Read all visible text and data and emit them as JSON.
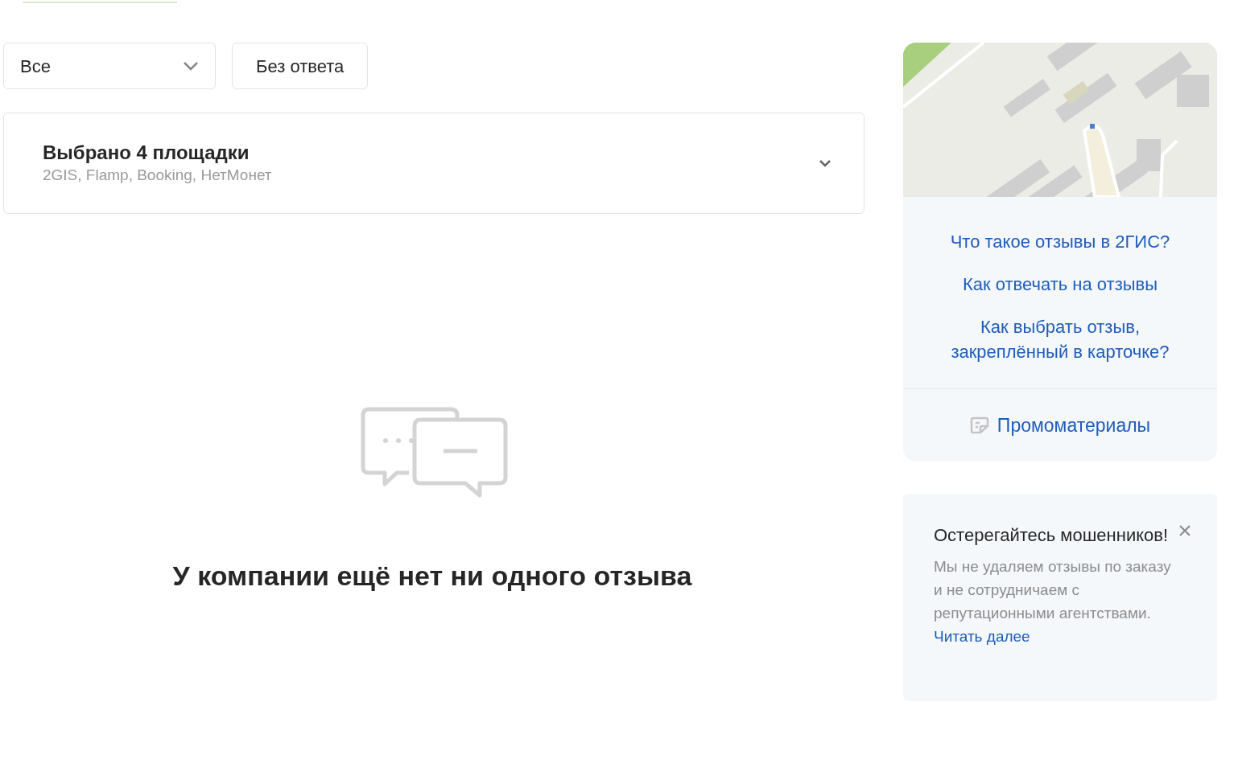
{
  "filters": {
    "status_select": {
      "value": "Все"
    },
    "unanswered_button": {
      "label": "Без ответа",
      "selected": false
    }
  },
  "platforms": {
    "title": "Выбрано 4 площадки",
    "subtitle": "2GIS, Flamp, Booking, НетМонет",
    "expanded": false
  },
  "empty_state": {
    "message": "У компании ещё нет ни одного отзыва"
  },
  "help_links": [
    "Что такое отзывы в 2ГИС?",
    "Как отвечать на отзывы",
    "Как выбрать отзыв, закреплённый в карточке?"
  ],
  "promo_link": "Промоматериалы",
  "warning": {
    "title": "Остерегайтесь мошенников!",
    "text": "Мы не удаляем отзывы по заказу и не сотрудничаем с репутационными агентствами.",
    "link": "Читать далее"
  }
}
